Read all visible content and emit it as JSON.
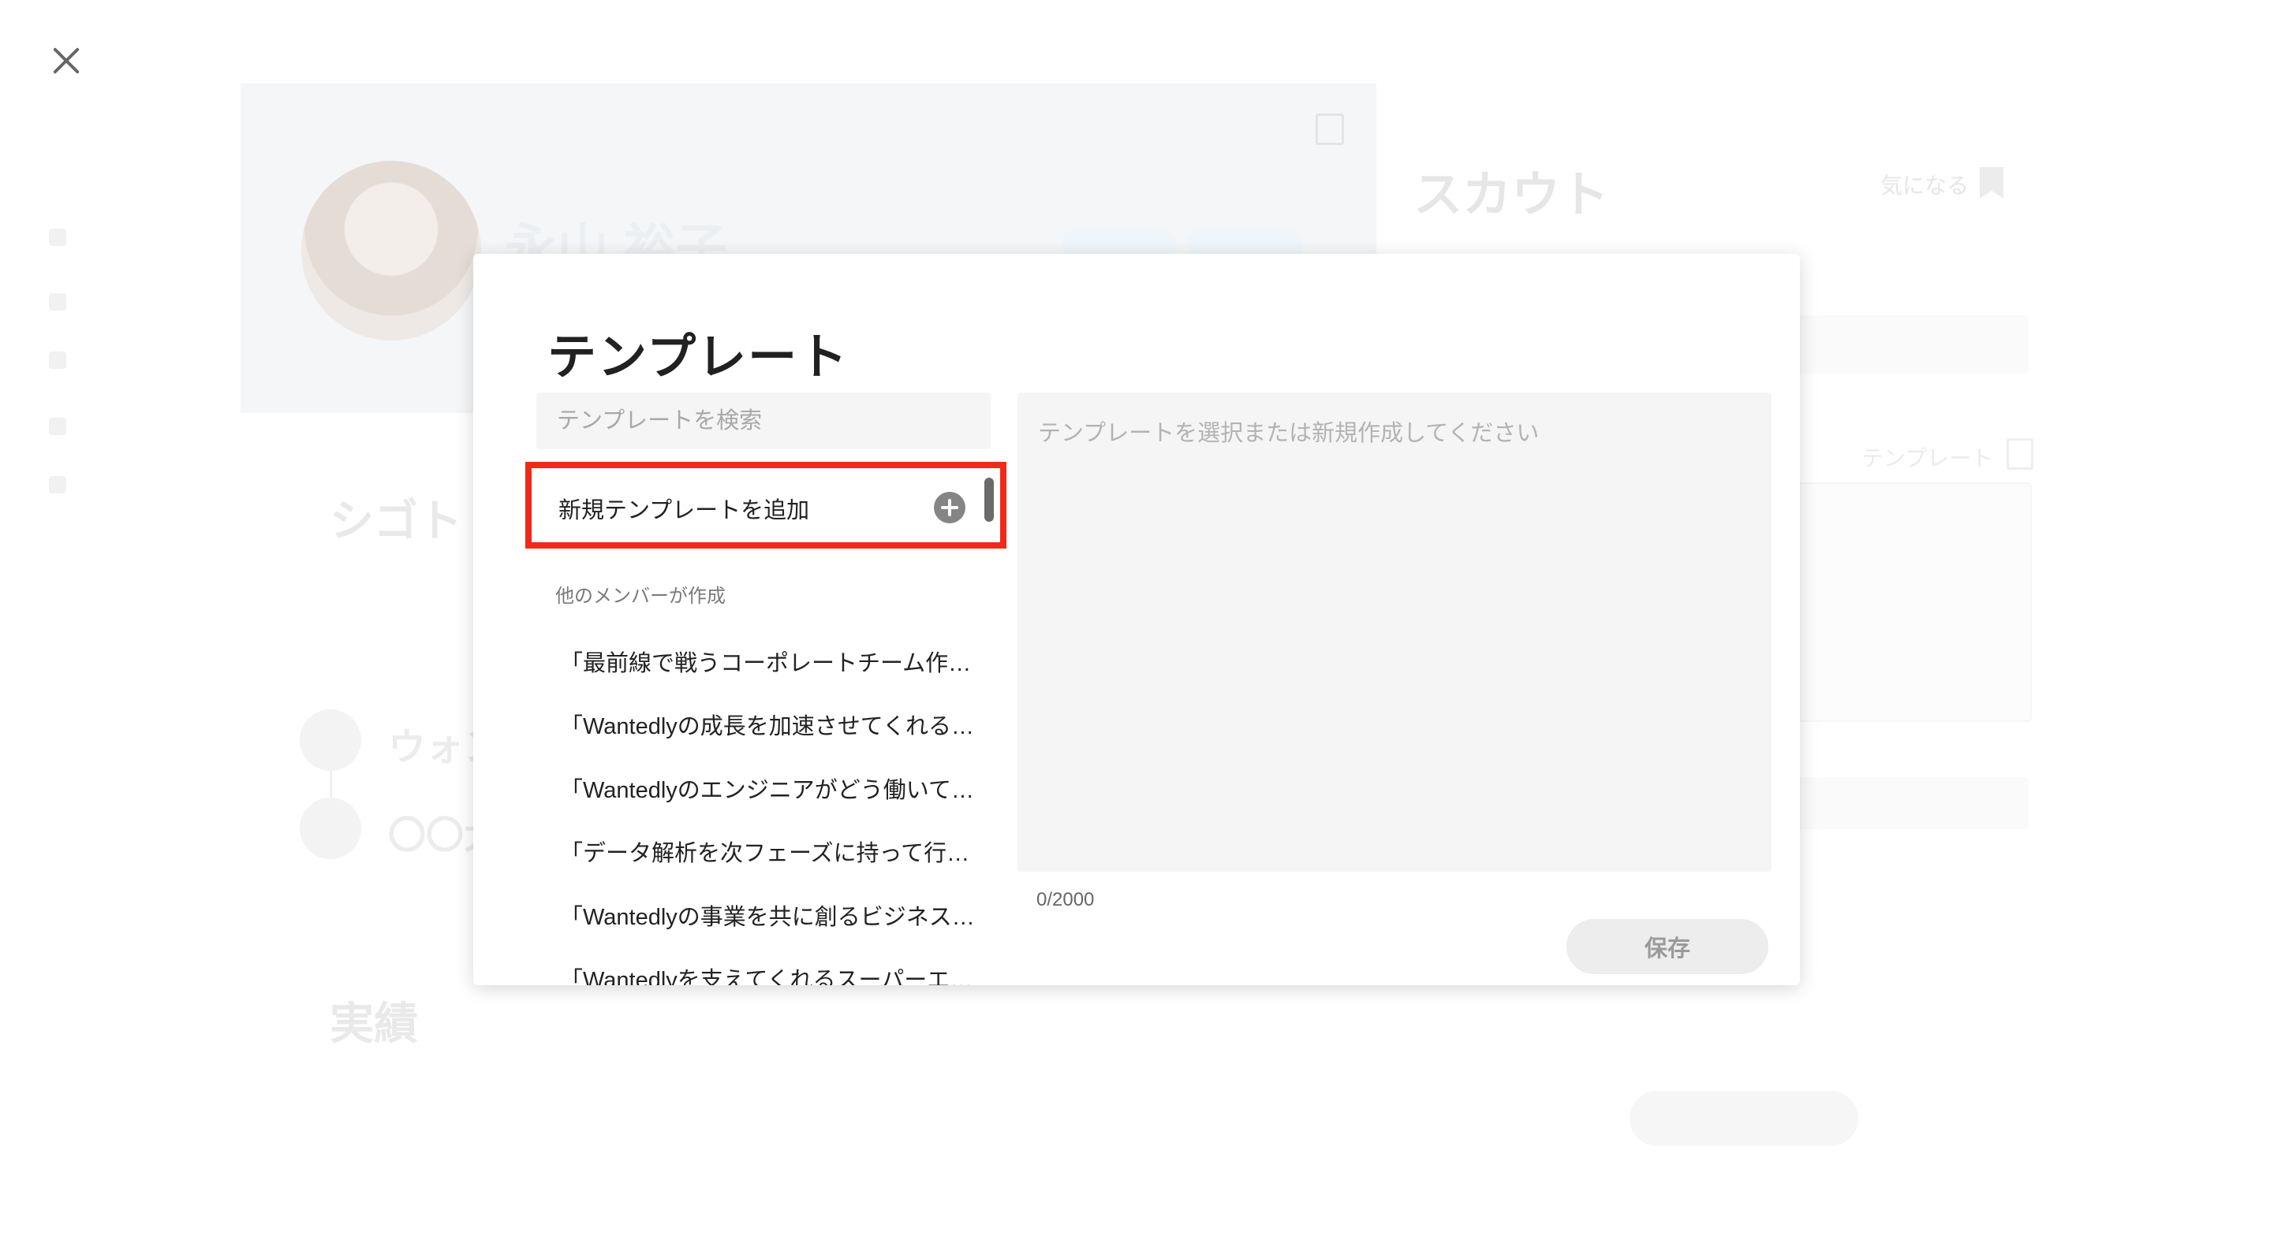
{
  "background": {
    "profile_name": "永山 裕子",
    "section_work": "シゴト",
    "timeline_item_1": "ウォン",
    "timeline_item_2": "〇〇大",
    "section_achievements": "実績",
    "scout_title": "スカウト",
    "bookmark_label": "気になる",
    "template_label": "テンプレート"
  },
  "modal": {
    "title": "テンプレート",
    "search_placeholder": "テンプレートを検索",
    "new_template_label": "新規テンプレートを追加",
    "group_label": "他のメンバーが作成",
    "templates": [
      "「最前線で戦うコーポレートチーム作…",
      "「Wantedlyの成長を加速させてくれる…",
      "「Wantedlyのエンジニアがどう働いて…",
      "「データ解析を次フェーズに持って行…",
      "「Wantedlyの事業を共に創るビジネス…",
      "「Wantedlyを支えてくれるスーパーエ…"
    ],
    "editor_placeholder": "テンプレートを選択または新規作成してください",
    "char_counter": "0/2000",
    "save_label": "保存"
  },
  "colors": {
    "highlight_border": "#f0291a",
    "input_background": "#f5f5f5",
    "save_button_background": "#ededed"
  },
  "icons": {
    "close": "close-icon",
    "add": "plus-circle-icon",
    "bookmark": "bookmark-icon",
    "copy": "copy-icon"
  }
}
